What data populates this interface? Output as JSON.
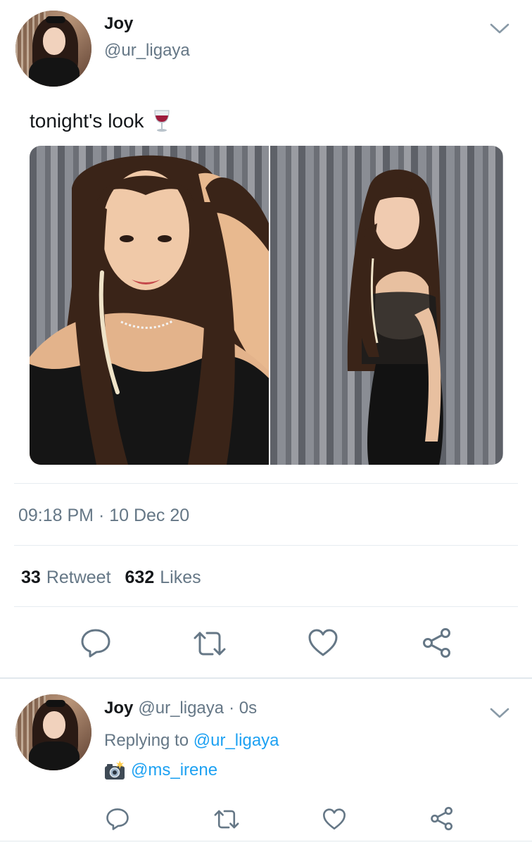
{
  "tweet": {
    "author_name": "Joy",
    "author_handle": "@ur_ligaya",
    "text": "tonight's look",
    "text_emoji": "wine-glass",
    "timestamp": "09:18 PM · 10 Dec 20",
    "retweet_count": "33",
    "retweet_label": "Retweet",
    "like_count": "632",
    "like_label": "Likes"
  },
  "reply": {
    "author_name": "Joy",
    "author_handle": "@ur_ligaya",
    "time": "· 0s",
    "replying_prefix": "Replying to",
    "replying_to": "@ur_ligaya",
    "mention_emoji": "camera-flash",
    "mention": "@ms_irene"
  },
  "colors": {
    "accent": "#1da1f2",
    "icon": "#657786",
    "text": "#14171a",
    "muted": "#657786"
  },
  "icons": [
    "chevron-down-icon",
    "reply-icon",
    "retweet-icon",
    "like-icon",
    "share-icon"
  ]
}
